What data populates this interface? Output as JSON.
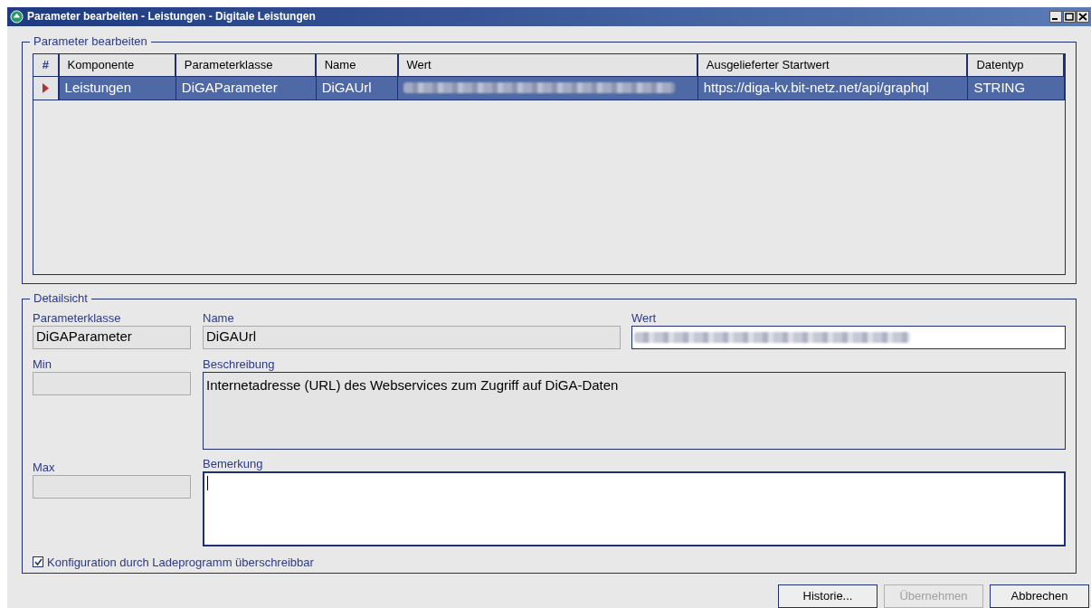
{
  "window": {
    "title": "Parameter bearbeiten - Leistungen - Digitale Leistungen"
  },
  "parameters_group": {
    "title": "Parameter bearbeiten",
    "table": {
      "columns": [
        "#",
        "Komponente",
        "Parameterklasse",
        "Name",
        "Wert",
        "Ausgelieferter Startwert",
        "Datentyp"
      ],
      "rows": [
        {
          "selected": true,
          "current": true,
          "cells": [
            "",
            "Leistungen",
            "DiGAParameter",
            "DiGAUrl",
            null,
            "https://diga-kv.bit-netz.net/api/graphql",
            "STRING"
          ]
        }
      ]
    }
  },
  "detail_group": {
    "title": "Detailsicht",
    "parameterklasse": {
      "label": "Parameterklasse",
      "value": "DiGAParameter"
    },
    "name": {
      "label": "Name",
      "value": "DiGAUrl"
    },
    "wert": {
      "label": "Wert"
    },
    "min": {
      "label": "Min"
    },
    "beschreibung": {
      "label": "Beschreibung",
      "value": "Internetadresse (URL) des Webservices zum Zugriff auf DiGA-Daten"
    },
    "max": {
      "label": "Max"
    },
    "bemerkung": {
      "label": "Bemerkung",
      "focused": true
    },
    "overwritable": {
      "label": "Konfiguration durch Ladeprogramm überschreibbar",
      "checked": true
    }
  },
  "buttons": [
    {
      "label": "Historie...",
      "disabled": false
    },
    {
      "label": "Übernehmen",
      "disabled": true
    },
    {
      "label": "Abbrechen",
      "disabled": false
    }
  ]
}
